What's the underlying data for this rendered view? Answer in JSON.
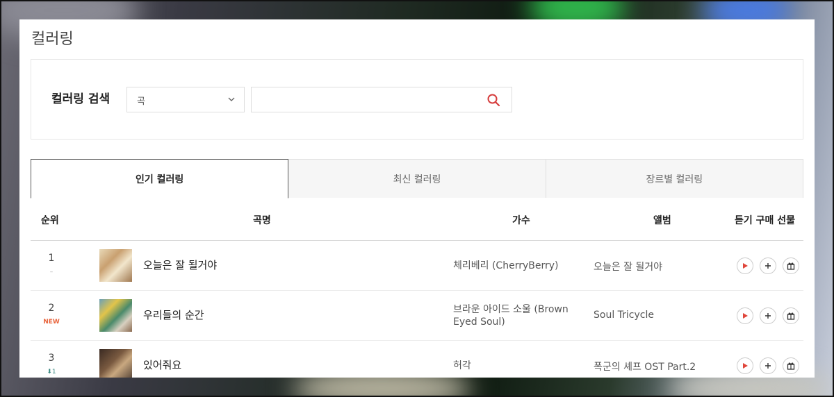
{
  "page": {
    "title": "컬러링"
  },
  "search": {
    "label": "컬러링 검색",
    "select_value": "곡",
    "input_value": "",
    "input_placeholder": ""
  },
  "tabs": [
    {
      "label": "인기 컬러링",
      "active": true
    },
    {
      "label": "최신 컬러링",
      "active": false
    },
    {
      "label": "장르별 컬러링",
      "active": false
    }
  ],
  "table": {
    "headers": {
      "rank": "순위",
      "song": "곡명",
      "artist": "가수",
      "album": "앨범",
      "actions": "듣기 구매 선물"
    },
    "rows": [
      {
        "rank": "1",
        "change": "–",
        "change_type": "same",
        "song": "오늘은 잘 될거야",
        "artist": "체리베리 (CherryBerry)",
        "album": "오늘은 잘 될거야"
      },
      {
        "rank": "2",
        "change": "NEW",
        "change_type": "new",
        "song": "우리들의 순간",
        "artist": "브라운 아이드 소울 (Brown Eyed Soul)",
        "album": "Soul Tricycle"
      },
      {
        "rank": "3",
        "change": "1",
        "change_type": "down",
        "song": "있어줘요",
        "artist": "허각",
        "album": "폭군의 셰프 OST Part.2"
      }
    ]
  },
  "icons": {
    "select_arrow": "chevron-down-icon",
    "search": "search-icon",
    "listen": "play-icon",
    "buy": "plus-icon",
    "gift": "gift-icon",
    "rank_down": "arrow-down-icon"
  },
  "colors": {
    "accent_red": "#e0463b",
    "new_badge": "#e8643c",
    "rank_down": "#3b8a82"
  }
}
